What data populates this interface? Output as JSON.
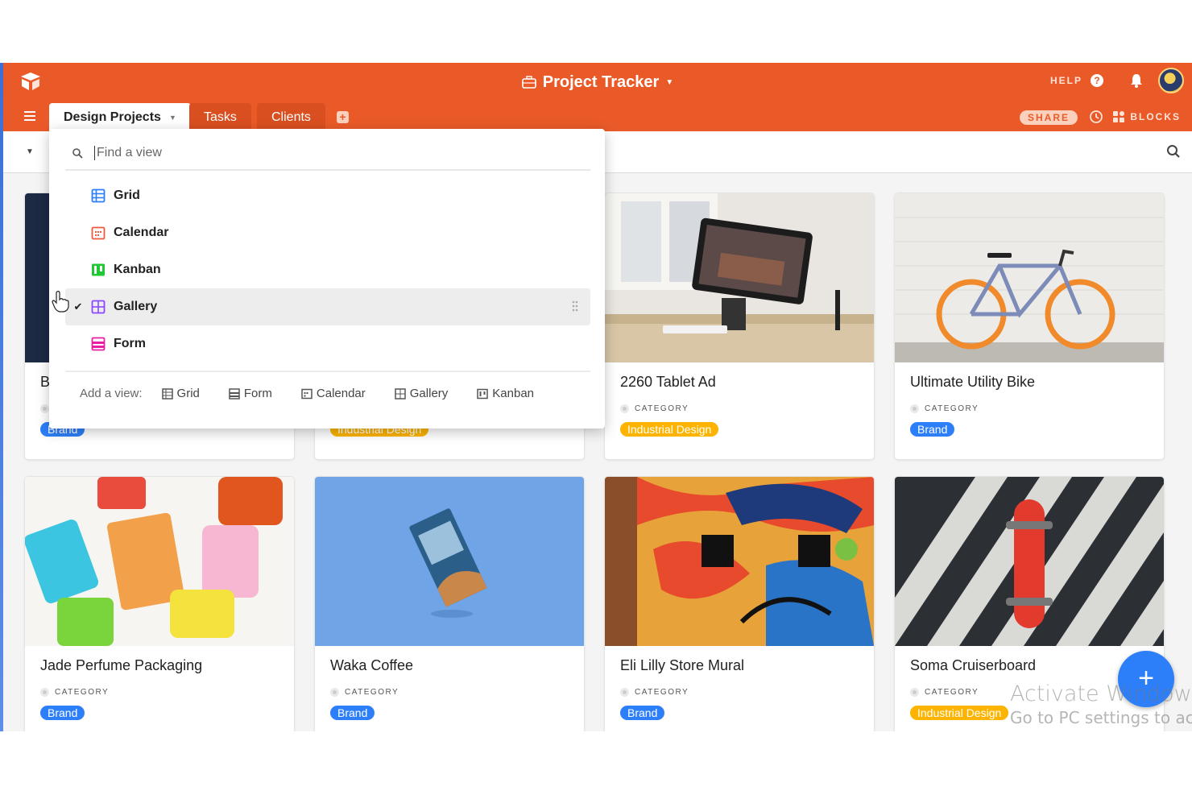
{
  "header": {
    "title": "Project Tracker",
    "help_label": "HELP",
    "share_label": "SHARE",
    "blocks_label": "BLOCKS"
  },
  "tabs": [
    {
      "label": "Design Projects"
    },
    {
      "label": "Tasks"
    },
    {
      "label": "Clients"
    }
  ],
  "dropdown": {
    "search_placeholder": "Find a view",
    "views": [
      {
        "label": "Grid",
        "icon": "grid-icon",
        "color": "#2d7ff9"
      },
      {
        "label": "Calendar",
        "icon": "calendar-icon",
        "color": "#f82b60"
      },
      {
        "label": "Kanban",
        "icon": "kanban-icon",
        "color": "#20c933"
      },
      {
        "label": "Gallery",
        "icon": "gallery-icon",
        "color": "#8b46ff",
        "selected": true
      },
      {
        "label": "Form",
        "icon": "form-icon",
        "color": "#ff08c2"
      }
    ],
    "add_view_label": "Add a view:",
    "add_options": [
      "Grid",
      "Form",
      "Calendar",
      "Gallery",
      "Kanban"
    ]
  },
  "gallery": {
    "field_label": "CATEGORY",
    "cards": [
      {
        "name": "B",
        "category": "Brand",
        "image": "poster-image"
      },
      {
        "name": "",
        "category": "Industrial Design",
        "image": "hidden-image"
      },
      {
        "name": "2260 Tablet Ad",
        "category": "Industrial Design",
        "image": "tablet-image"
      },
      {
        "name": "Ultimate Utility Bike",
        "category": "Brand",
        "image": "bike-image"
      },
      {
        "name": "Jade Perfume Packaging",
        "category": "Brand",
        "image": "perfume-image"
      },
      {
        "name": "Waka Coffee",
        "category": "Brand",
        "image": "coffee-image"
      },
      {
        "name": "Eli Lilly Store Mural",
        "category": "Brand",
        "image": "mural-image"
      },
      {
        "name": "Soma Cruiserboard",
        "category": "Industrial Design",
        "image": "skateboard-image"
      }
    ]
  },
  "watermark": {
    "line1": "Activate Windows",
    "line2": "Go to PC settings to activ"
  },
  "colors": {
    "brand": "#ea5a28",
    "badge_brand": "#2d7ff9",
    "badge_industrial": "#fcb400"
  }
}
